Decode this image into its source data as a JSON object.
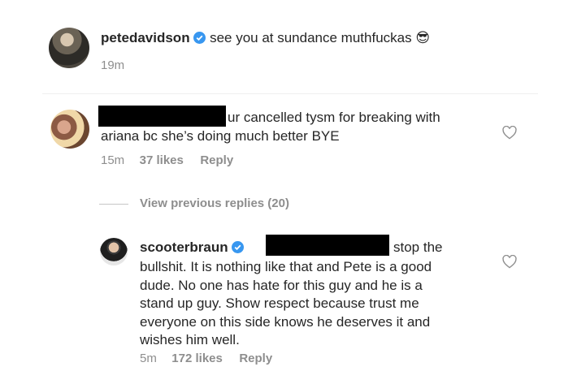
{
  "post": {
    "username": "petedavidson",
    "caption": "see you at sundance muthfuckas",
    "emoji": "😎",
    "time": "19m"
  },
  "comment": {
    "text_line1": "ur cancelled tysm for breaking with",
    "text_line2": "ariana bc she’s doing much better BYE",
    "time": "15m",
    "likes": "37 likes",
    "reply": "Reply"
  },
  "thread": {
    "view_previous": "View previous replies (20)"
  },
  "reply_comment": {
    "username": "scooterbraun",
    "line1_tail": "stop the",
    "lines": [
      "bullshit. It is nothing like that and Pete is a good",
      "dude. No one has hate for this guy and he is a",
      "stand up guy. Show respect because trust me",
      "everyone on this side knows he deserves it and",
      "wishes him well."
    ],
    "time": "5m",
    "likes": "172 likes",
    "reply": "Reply"
  },
  "colors": {
    "verified": "#3897f0",
    "meta": "#8e8e8e",
    "text": "#262626"
  }
}
